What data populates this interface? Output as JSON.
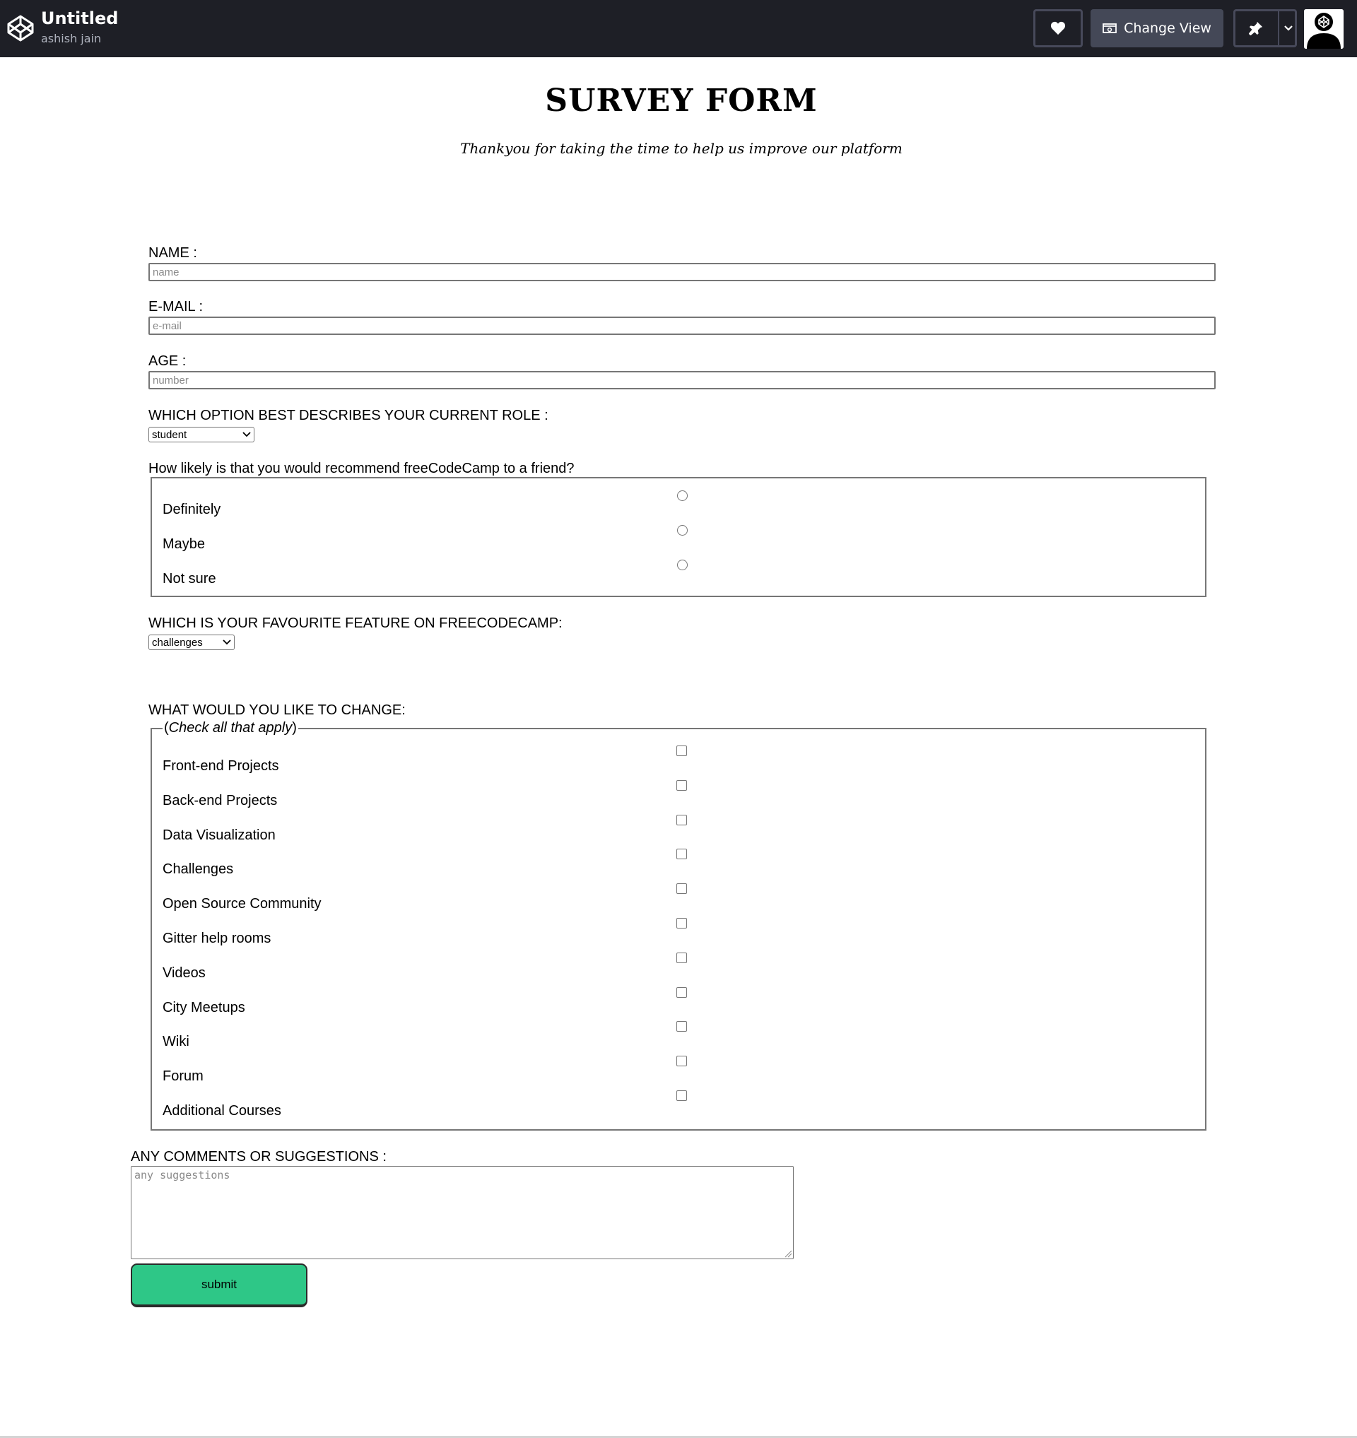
{
  "header": {
    "title": "Untitled",
    "author": "ashish jain",
    "change_view_label": "Change View",
    "icons": [
      "codepen-logo-icon",
      "heart-icon",
      "change-view-icon",
      "pin-icon",
      "chevron-down-icon",
      "avatar-icon"
    ]
  },
  "survey": {
    "title": "SURVEY FORM",
    "subtitle": "Thankyou for taking the time to help us improve our platform"
  },
  "form": {
    "name": {
      "label": "NAME :",
      "placeholder": "name",
      "value": ""
    },
    "email": {
      "label": "E-MAIL :",
      "placeholder": "e-mail",
      "value": ""
    },
    "age": {
      "label": "AGE :",
      "placeholder": "number",
      "value": ""
    },
    "role": {
      "label": "WHICH OPTION BEST DESCRIBES YOUR CURRENT ROLE :",
      "selected": "student"
    },
    "recommend": {
      "label": "How likely is that you would recommend freeCodeCamp to a friend?",
      "options": [
        "Definitely",
        "Maybe",
        "Not sure"
      ],
      "selected": null
    },
    "feature": {
      "label": "WHICH IS YOUR FAVOURITE FEATURE ON FREECODECAMP:",
      "selected": "challenges"
    },
    "improve": {
      "label": "WHAT WOULD YOU LIKE TO CHANGE:",
      "legend_open": "(",
      "legend_text": "Check all that apply",
      "legend_close": ")",
      "options": [
        "Front-end Projects",
        "Back-end Projects",
        "Data Visualization",
        "Challenges",
        "Open Source Community",
        "Gitter help rooms",
        "Videos",
        "City Meetups",
        "Wiki",
        "Forum",
        "Additional Courses"
      ],
      "checked": []
    },
    "comments": {
      "label": "ANY COMMENTS OR SUGGESTIONS :",
      "placeholder": "any suggestions",
      "value": ""
    },
    "submit_label": "submit"
  },
  "colors": {
    "topbar": "#1e1f26",
    "change_view_button": "#444857",
    "submit_button": "#2ec787"
  }
}
